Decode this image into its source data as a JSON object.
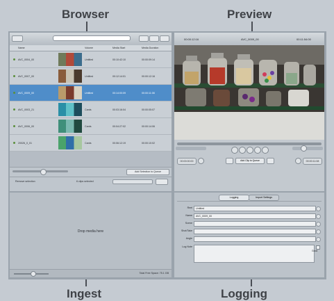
{
  "callouts": {
    "browser": "Browser",
    "preview": "Preview",
    "ingest": "Ingest",
    "logging": "Logging"
  },
  "browser": {
    "columns": [
      "Name",
      "Volume",
      "Media Start",
      "Media Duration"
    ],
    "rows": [
      {
        "name": "AVC_0004_00",
        "volume": "Untitled",
        "start": "00:10:42:10",
        "duration": "00:00:09:14",
        "thumb": [
          "#6f7a5a",
          "#b04a3a",
          "#3c6d8d"
        ]
      },
      {
        "name": "AVC_0007_00",
        "volume": "Untitled",
        "start": "00:12:14:01",
        "duration": "00:00:12:16",
        "thumb": [
          "#8a5c3a",
          "#c8c2b2",
          "#4a3a2c"
        ]
      },
      {
        "name": "AVC_0009_00",
        "volume": "Untitled",
        "start": "00:14:00:09",
        "duration": "00:00:11:08",
        "thumb": [
          "#b99a6a",
          "#7a3b2c",
          "#d9d2c1"
        ]
      },
      {
        "name": "AVC_0003_21",
        "volume": "Cards",
        "start": "00:03:16:04",
        "duration": "00:00:05:07",
        "thumb": [
          "#2a8fa6",
          "#5fc1c8",
          "#1d4d5c"
        ]
      },
      {
        "name": "AVC_0006_00",
        "volume": "Cards",
        "start": "00:04:27:02",
        "duration": "00:00:14:06",
        "thumb": [
          "#3f8f7a",
          "#7bb9b0",
          "#214a40"
        ]
      },
      {
        "name": "20026_0_01",
        "volume": "Cards",
        "start": "00:06:12:19",
        "duration": "00:00:10:02",
        "thumb": [
          "#4aa36b",
          "#2f6fa8",
          "#a7c7a0"
        ]
      }
    ],
    "footer_button": "Add Selection to Queue",
    "footer_status": "6 clips selected",
    "footer_left": "Remove selection"
  },
  "preview": {
    "clip_name": "AVC_0009_00",
    "tc_left": "00:00:12:16",
    "tc_right": "00:11:54:00",
    "btn_add": "Add Clip to Queue",
    "tc_in": "00:00:00:00",
    "tc_out": "00:00:11:08"
  },
  "ingest": {
    "drop_text": "Drop media here",
    "free_space": "Total Free Space: 75.1 GB"
  },
  "logging": {
    "tabs": [
      "Logging",
      "Import Settings"
    ],
    "fields": [
      {
        "label": "Reel",
        "value": "Untitled"
      },
      {
        "label": "Name",
        "value": "AVC_0009_00"
      },
      {
        "label": "Scene",
        "value": ""
      },
      {
        "label": "Shot/Take",
        "value": ""
      },
      {
        "label": "Angle",
        "value": ""
      }
    ],
    "notes_label": "Log Note",
    "good_label": "Good"
  },
  "colors": {
    "selection": "#4f8dc9",
    "frame": "#9aa3ac"
  }
}
